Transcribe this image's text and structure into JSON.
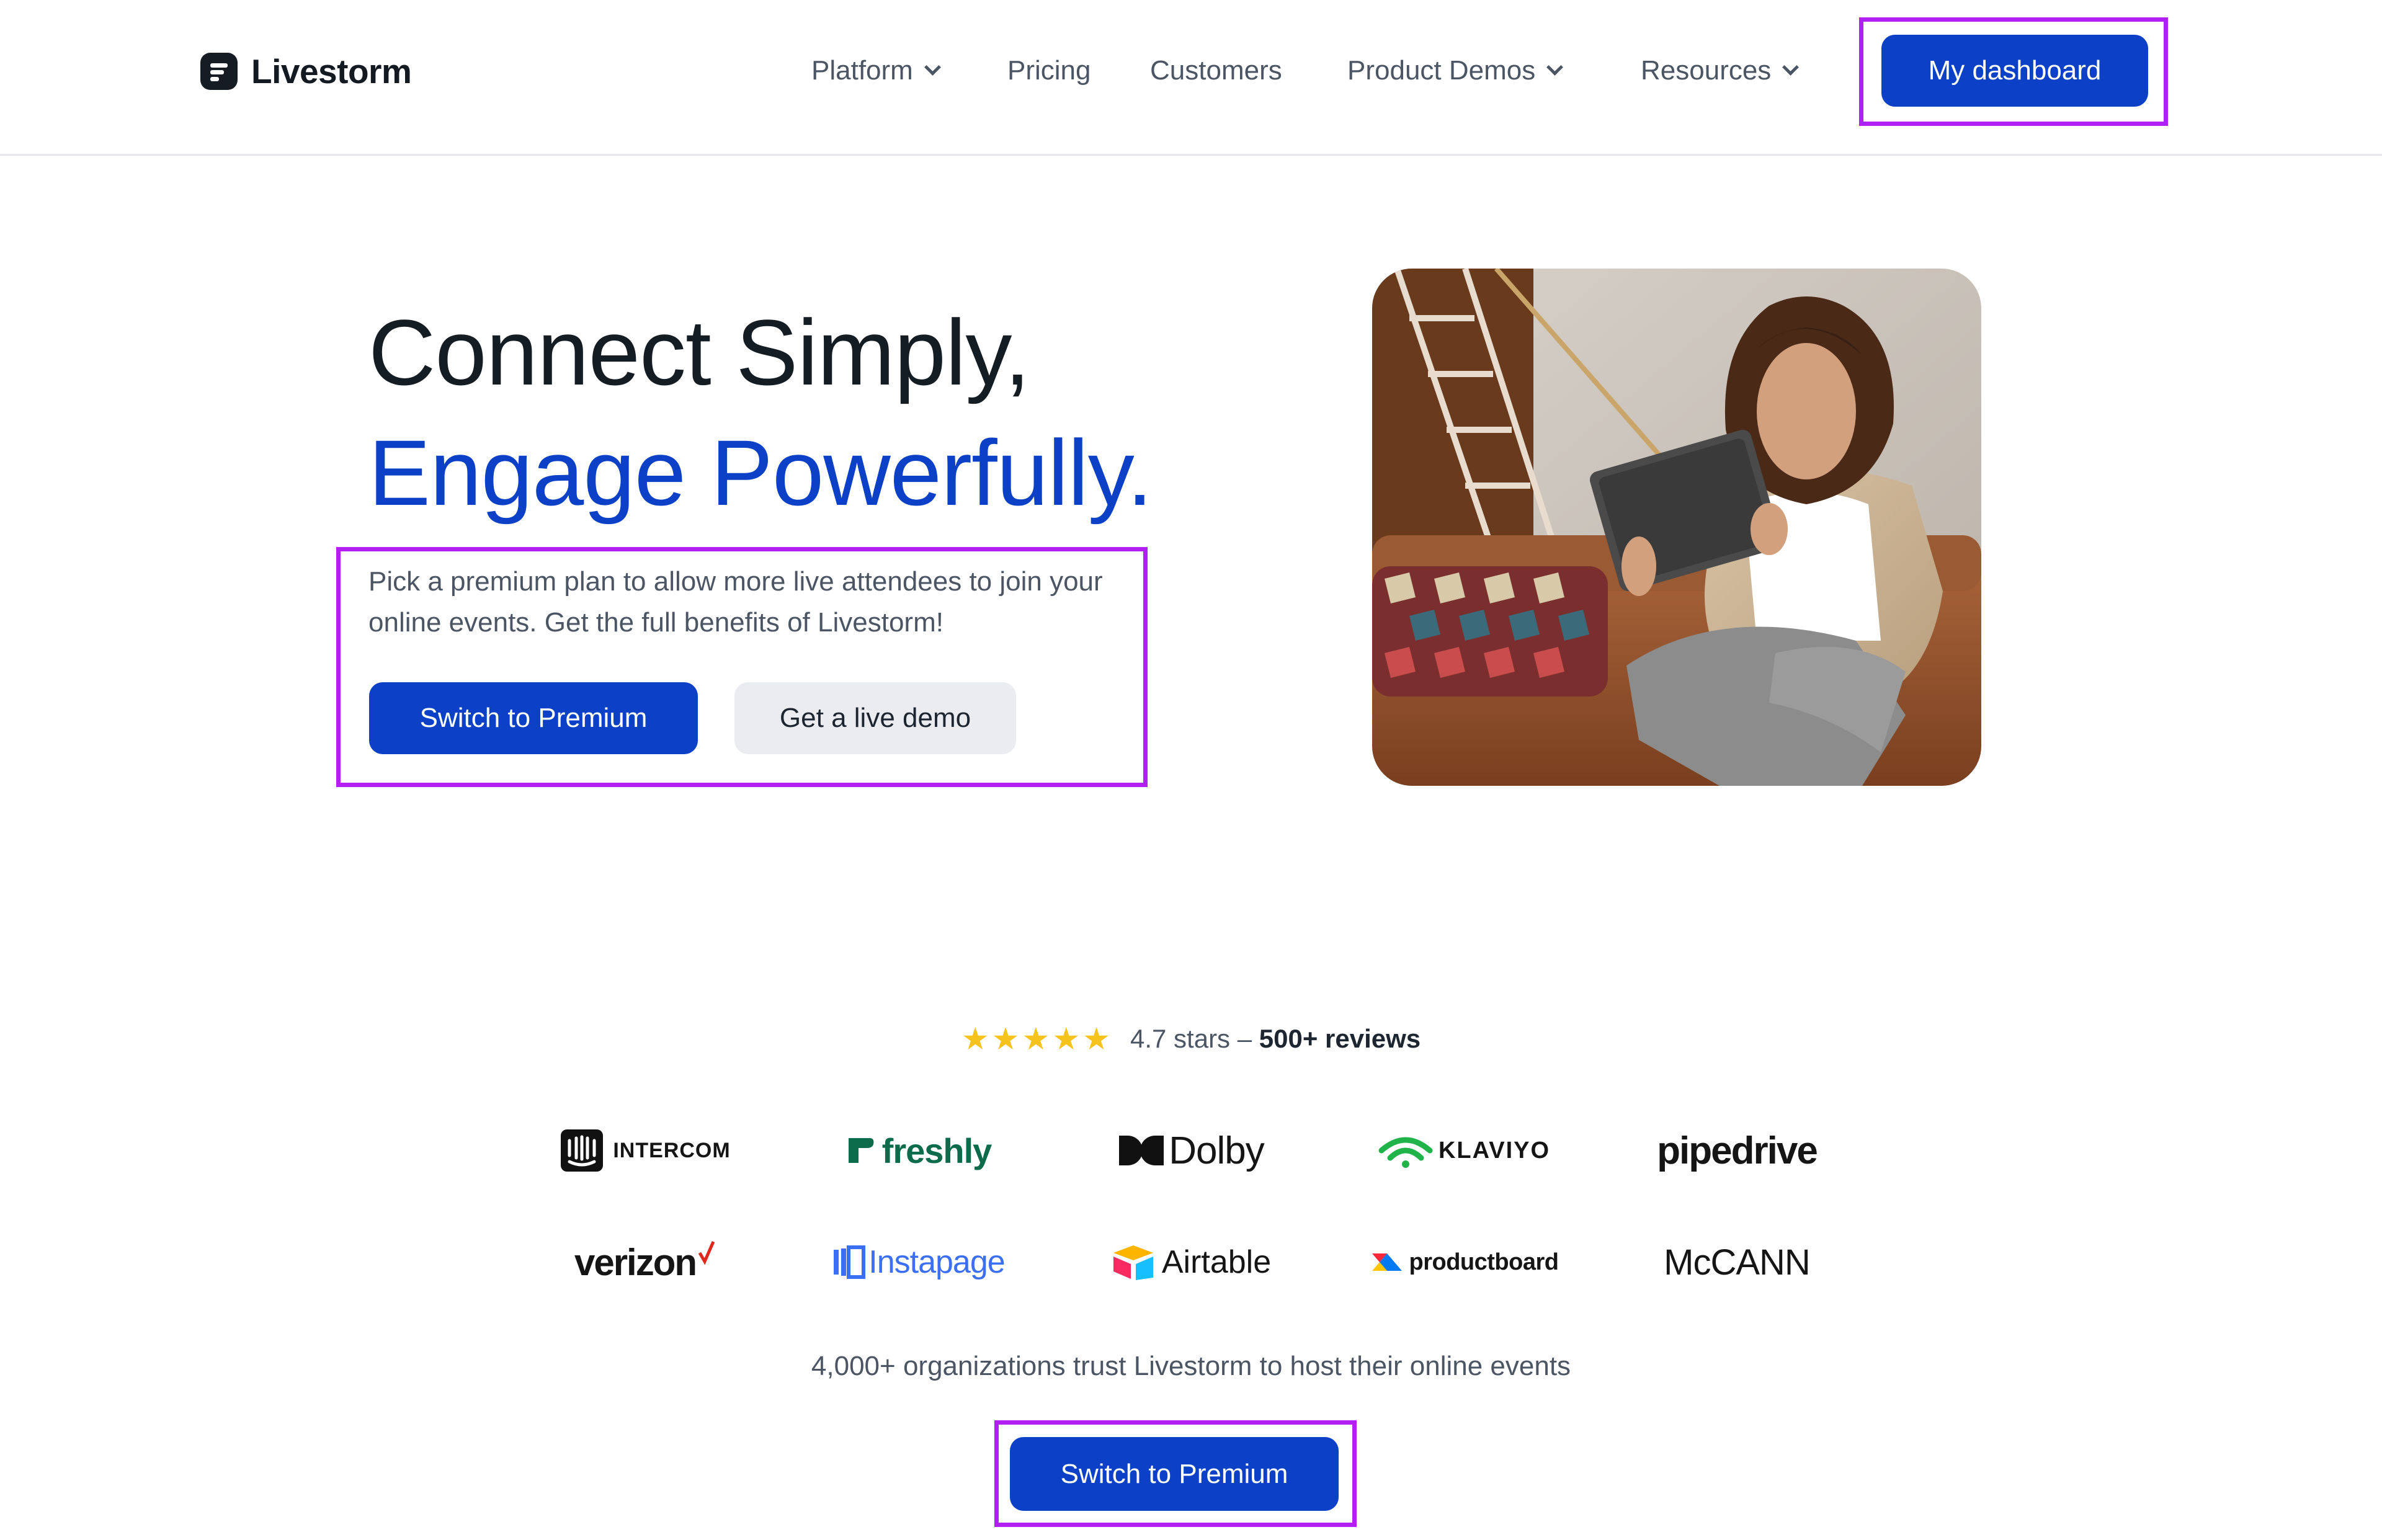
{
  "header": {
    "logo_text": "Livestorm",
    "nav": [
      {
        "label": "Platform",
        "dropdown": true
      },
      {
        "label": "Pricing",
        "dropdown": false
      },
      {
        "label": "Customers",
        "dropdown": false
      },
      {
        "label": "Product Demos",
        "dropdown": true
      },
      {
        "label": "Resources",
        "dropdown": true
      }
    ],
    "dashboard_button": "My dashboard"
  },
  "hero": {
    "title_line1": "Connect Simply,",
    "title_line2": "Engage Powerfully.",
    "description": "Pick a premium plan to allow more live attendees to join your online events. Get the full benefits of Livestorm!",
    "primary_button": "Switch to Premium",
    "secondary_button": "Get a live demo"
  },
  "rating": {
    "stars": 5,
    "score_text": "4.7 stars –",
    "reviews_text": "500+ reviews"
  },
  "logos": {
    "row1": [
      "INTERCOM",
      "freshly",
      "Dolby",
      "KLAVIYO",
      "pipedrive"
    ],
    "row2": [
      "verizon",
      "Instapage",
      "Airtable",
      "productboard",
      "McCANN"
    ]
  },
  "trust_text": "4,000+ organizations trust Livestorm to host their online events",
  "bottom_button": "Switch to Premium",
  "colors": {
    "brand_blue": "#0b40c7",
    "highlight": "#b21ff2",
    "star": "#f6c21c"
  }
}
